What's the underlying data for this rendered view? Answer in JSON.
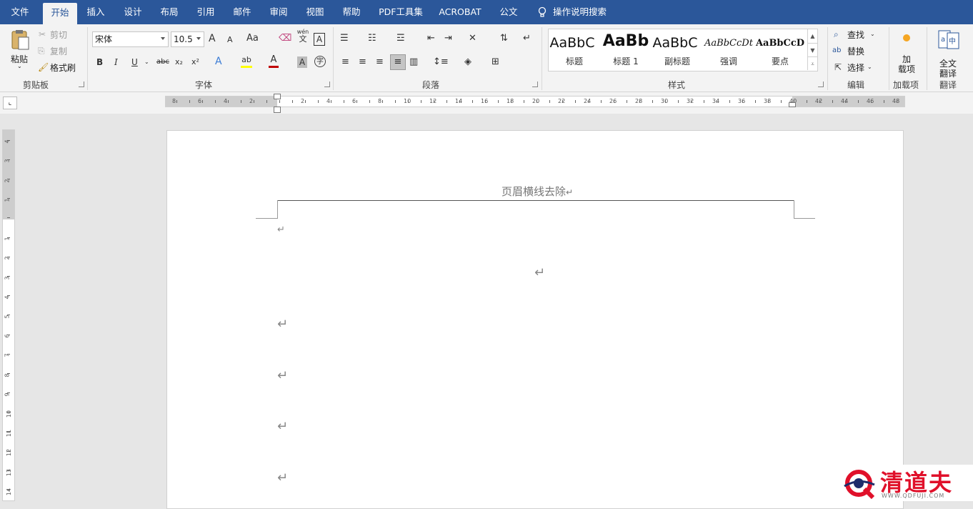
{
  "tabs": [
    "文件",
    "开始",
    "插入",
    "设计",
    "布局",
    "引用",
    "邮件",
    "审阅",
    "视图",
    "帮助",
    "PDF工具集",
    "ACROBAT",
    "公文"
  ],
  "tell_me": "操作说明搜索",
  "clipboard": {
    "paste": "粘贴",
    "cut": "剪切",
    "copy": "复制",
    "format_painter": "格式刷",
    "label": "剪贴板"
  },
  "font": {
    "name": "宋体",
    "size": "10.5",
    "label": "字体",
    "change_case": "Aa",
    "bold": "B",
    "italic": "I",
    "underline": "U",
    "strike": "abc",
    "sub": "x₂",
    "sup": "x²",
    "phonetic_top": "wén",
    "phonetic_bottom": "文",
    "char_border": "A",
    "grow": "A",
    "shrink": "A"
  },
  "paragraph": {
    "label": "段落"
  },
  "styles": {
    "label": "样式",
    "items": [
      {
        "sample": "AaBbC",
        "name": "标题"
      },
      {
        "sample": "AaBb",
        "name": "标题 1"
      },
      {
        "sample": "AaBbC",
        "name": "副标题"
      },
      {
        "sample": "AaBbCcDt",
        "name": "强调"
      },
      {
        "sample": "AaBbCcD",
        "name": "要点"
      }
    ]
  },
  "editing": {
    "find": "查找",
    "replace": "替换",
    "select": "选择",
    "label": "编辑"
  },
  "addins": {
    "button_line1": "加",
    "button_line2": "载项",
    "label": "加载项"
  },
  "translate": {
    "button_line1": "全文",
    "button_line2": "翻译",
    "label": "翻译"
  },
  "hruler_labels": [
    "8",
    "6",
    "4",
    "2",
    "2",
    "4",
    "6",
    "8",
    "10",
    "12",
    "14",
    "16",
    "18",
    "20",
    "22",
    "24",
    "26",
    "28",
    "30",
    "32",
    "34",
    "36",
    "38",
    "40",
    "42",
    "44",
    "46",
    "48"
  ],
  "vruler_labels": [
    "4",
    "3",
    "2",
    "1",
    "1",
    "2",
    "3",
    "4",
    "5",
    "6",
    "7",
    "8",
    "9",
    "10",
    "11",
    "12",
    "13",
    "14"
  ],
  "document": {
    "header_text": "页眉横线去除",
    "return_mark": "↵"
  },
  "watermark": {
    "brand": "清道夫",
    "url": "WWW.QDFUJI.COM"
  },
  "colors": {
    "tabbar": "#2b579a",
    "ribbon": "#f3f3f3",
    "font_color": "#c00000",
    "highlight": "#ffff00",
    "watermark_red": "#e0102a"
  }
}
